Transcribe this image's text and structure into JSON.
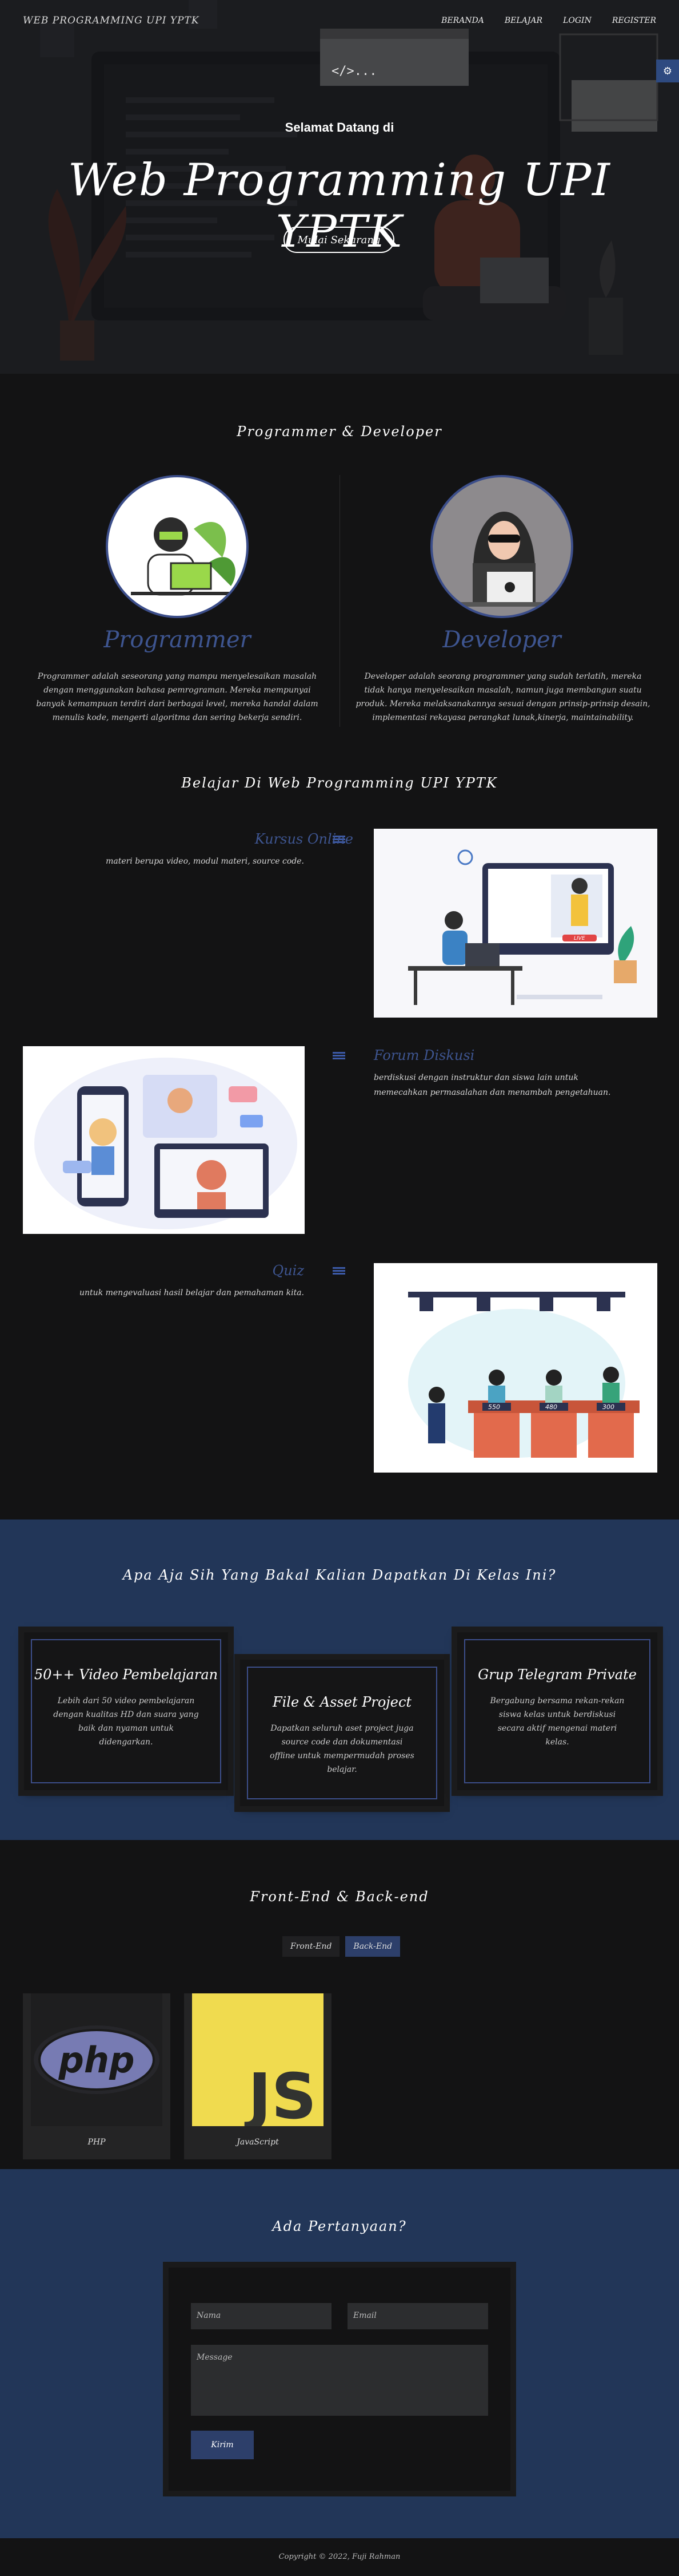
{
  "navbar": {
    "brand": "WEB PROGRAMMING UPI YPTK",
    "links": [
      "BERANDA",
      "BELAJAR",
      "LOGIN",
      "REGISTER"
    ]
  },
  "hero": {
    "subtitle": "Selamat Datang di",
    "title": "Web Programming UPI YPTK",
    "button": "Mulai Sekarang",
    "code_tag": "</>..."
  },
  "about": {
    "title": "Programmer & Developer",
    "programmer": {
      "role": "Programmer",
      "text": "Programmer adalah seseorang yang mampu menyelesaikan masalah dengan menggunakan bahasa pemrograman. Mereka mempunyai banyak kemampuan terdiri dari berbagai level, mereka handal dalam menulis kode, mengerti algoritma dan sering bekerja sendiri."
    },
    "developer": {
      "role": "Developer",
      "text": "Developer adalah seorang programmer yang sudah terlatih, mereka tidak hanya menyelesaikan masalah, namun juga membangun suatu produk. Mereka melaksanakannya sesuai dengan prinsip-prinsip desain, implementasi rekayasa perangkat lunak,kinerja, maintainability."
    }
  },
  "learn": {
    "title": "Belajar Di Web Programming UPI YPTK",
    "items": [
      {
        "title": "Kursus Online",
        "text": "materi berupa video, modul materi, source code."
      },
      {
        "title": "Forum Diskusi",
        "text": "berdiskusi dengan instruktur dan siswa lain untuk memecahkan permasalahan dan menambah pengetahuan."
      },
      {
        "title": "Quiz",
        "text": "untuk mengevaluasi hasil belajar dan pemahaman kita."
      }
    ],
    "live_badge": "LIVE",
    "quiz_scores": [
      "550",
      "480",
      "300"
    ]
  },
  "benefits": {
    "title": "Apa Aja Sih Yang Bakal Kalian Dapatkan Di Kelas Ini?",
    "cards": [
      {
        "title": "50++ Video Pembelajaran",
        "text": "Lebih dari 50 video pembelajaran dengan kualitas HD dan suara yang baik dan nyaman untuk didengarkan."
      },
      {
        "title": "File & Asset Project",
        "text": "Dapatkan seluruh aset project juga source code dan dokumentasi offline untuk mempermudah proses belajar."
      },
      {
        "title": "Grup Telegram Private",
        "text": "Bergabung bersama rekan-rekan siswa kelas untuk berdiskusi secara aktif mengenai materi kelas."
      }
    ]
  },
  "stack": {
    "title": "Front-End & Back-end",
    "tabs": [
      "Front-End",
      "Back-End"
    ],
    "items": [
      {
        "label": "PHP",
        "logo": "php"
      },
      {
        "label": "JavaScript",
        "logo": "JS"
      }
    ]
  },
  "contact": {
    "title": "Ada Pertanyaan?",
    "name_placeholder": "Nama",
    "email_placeholder": "Email",
    "message_placeholder": "Message",
    "submit": "Kirim"
  },
  "footer": {
    "text": "Copyright © 2022, Fuji Rahman"
  },
  "colors": {
    "accent": "#3e5590",
    "section_blue": "#223658",
    "dark": "#131314"
  }
}
